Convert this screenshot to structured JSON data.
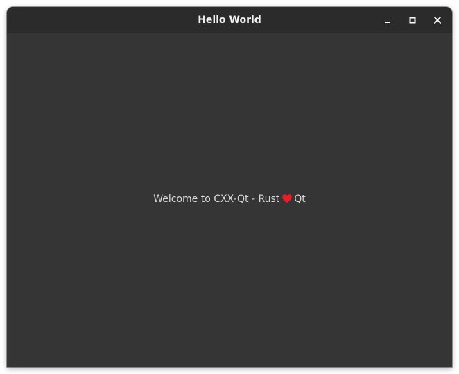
{
  "window": {
    "title": "Hello World"
  },
  "titlebar_buttons": {
    "minimize_icon": "minimize-icon",
    "maximize_icon": "maximize-icon",
    "close_icon": "close-icon"
  },
  "content": {
    "text_before": "Welcome to CXX-Qt - Rust",
    "heart_icon": "heart-icon",
    "heart_color": "#e0202a",
    "text_after": "Qt"
  },
  "colors": {
    "background": "#353535",
    "titlebar": "#2b2b2b"
  }
}
